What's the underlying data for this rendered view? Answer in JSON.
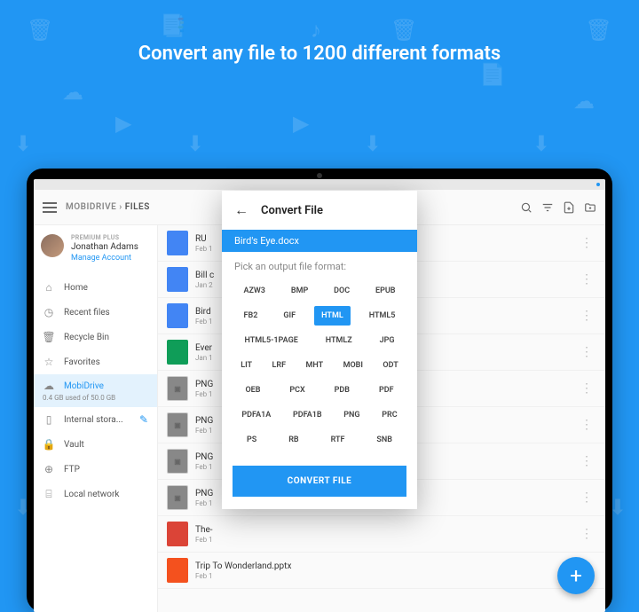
{
  "headline": "Convert any file to 1200 different formats",
  "appbar": {
    "breadcrumb_a": "MOBIDRIVE",
    "breadcrumb_b": "FILES"
  },
  "account": {
    "plan": "PREMIUM PLUS",
    "name": "Jonathan Adams",
    "manage": "Manage Account"
  },
  "nav": {
    "home": "Home",
    "recent": "Recent files",
    "recycle": "Recycle Bin",
    "favorites": "Favorites",
    "mobidrive": "MobiDrive",
    "mobidrive_sub": "0.4 GB used of 50.0 GB",
    "internal": "Internal stora...",
    "vault": "Vault",
    "ftp": "FTP",
    "local": "Local network"
  },
  "files": [
    {
      "name": "RU",
      "date": "Feb 1",
      "type": "doc"
    },
    {
      "name": "Bill c",
      "date": "Jan 2",
      "type": "doc"
    },
    {
      "name": "Bird",
      "date": "Feb 1",
      "type": "docx"
    },
    {
      "name": "Ever",
      "date": "Jan 1",
      "type": "sheet"
    },
    {
      "name": "PNG",
      "date": "Feb 1",
      "type": "png"
    },
    {
      "name": "PNG",
      "date": "Feb 1",
      "type": "png"
    },
    {
      "name": "PNG",
      "date": "Feb 1",
      "type": "png"
    },
    {
      "name": "PNG",
      "date": "Feb 1",
      "type": "png"
    },
    {
      "name": "The-",
      "date": "Feb 1",
      "type": "pdf"
    },
    {
      "name": "Trip To Wonderland.pptx",
      "date": "Feb 1",
      "type": "pptx"
    }
  ],
  "modal": {
    "title": "Convert File",
    "filename": "Bird's Eye.docx",
    "prompt": "Pick an output file format:",
    "formats": [
      "AZW3",
      "BMP",
      "DOC",
      "EPUB",
      "FB2",
      "GIF",
      "HTML",
      "HTML5",
      "HTML5-1PAGE",
      "HTMLZ",
      "JPG",
      "LIT",
      "LRF",
      "MHT",
      "MOBI",
      "ODT",
      "OEB",
      "PCX",
      "PDB",
      "PDF",
      "PDFA1A",
      "PDFA1B",
      "PNG",
      "PRC",
      "PS",
      "RB",
      "RTF",
      "SNB"
    ],
    "selected": "HTML",
    "button": "CONVERT FILE"
  }
}
